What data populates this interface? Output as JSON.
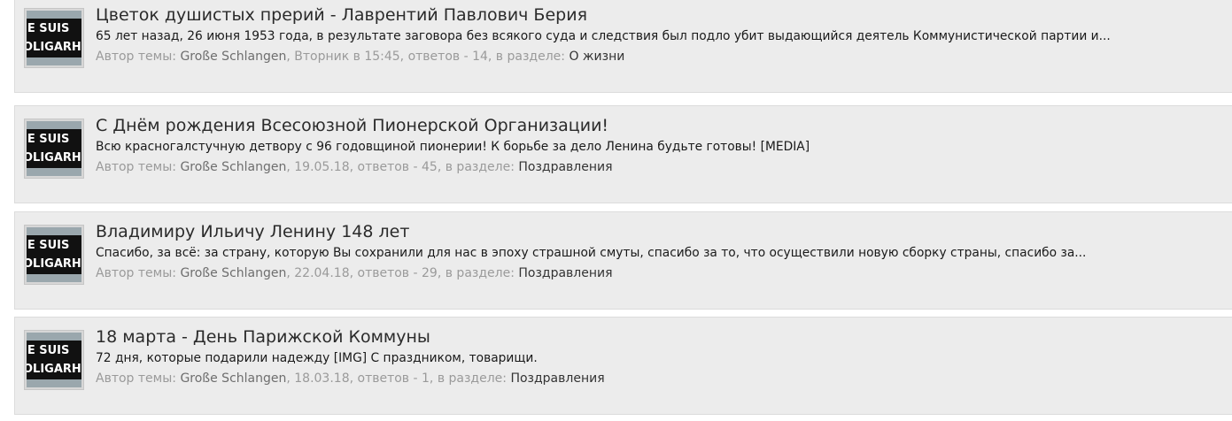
{
  "threads": [
    {
      "avatar_text": [
        "JE SUIS",
        "OLIGARH"
      ],
      "title": "Цветок душистых прерий - Лаврентий Павлович Берия",
      "snippet": "65 лет назад, 26 июня 1953 года, в результате заговора без всякого суда и следствия был подло убит выдающийся деятель Коммунистической партии и...",
      "author_label": "Автор темы: ",
      "author": "Große Schlangen",
      "date_text": ", Вторник в 15:45, ответов - 14, в разделе: ",
      "forum": "О жизни"
    },
    {
      "avatar_text": [
        "JE SUIS",
        "OLIGARH"
      ],
      "title": "С Днём рождения Всесоюзной Пионерской Организации!",
      "snippet": "Всю красногалстучную детвору с 96 годовщиной пионерии! К борьбе за дело Ленина будьте готовы! [MEDIA]",
      "author_label": "Автор темы: ",
      "author": "Große Schlangen",
      "date_text": ", 19.05.18, ответов - 45, в разделе: ",
      "forum": "Поздравления"
    },
    {
      "avatar_text": [
        "JE SUIS",
        "OLIGARH"
      ],
      "title": "Владимиру Ильичу Ленину 148 лет",
      "snippet": "Спасибо, за всё: за страну, которую Вы сохранили для нас в эпоху страшной смуты, спасибо за то, что осуществили новую сборку страны, спасибо за...",
      "author_label": "Автор темы: ",
      "author": "Große Schlangen",
      "date_text": ", 22.04.18, ответов - 29, в разделе: ",
      "forum": "Поздравления"
    },
    {
      "avatar_text": [
        "JE SUIS",
        "OLIGARH"
      ],
      "title": "18 марта - День Парижской Коммуны",
      "snippet": "72 дня, которые подарили надежду [IMG] С праздником, товарищи.",
      "author_label": "Автор темы: ",
      "author": "Große Schlangen",
      "date_text": ", 18.03.18, ответов - 1, в разделе: ",
      "forum": "Поздравления"
    }
  ]
}
